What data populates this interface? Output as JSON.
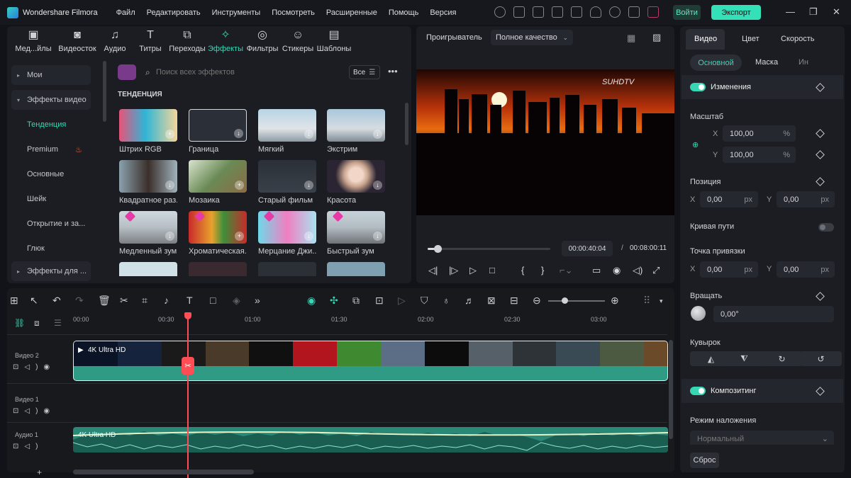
{
  "app": {
    "title": "Wondershare Filmora"
  },
  "menu": [
    "Файл",
    "Редактировать",
    "Инструменты",
    "Посмотреть",
    "Расширенные",
    "Помощь",
    "Версия"
  ],
  "titlebar": {
    "login": "Войти",
    "export": "Экспорт",
    "icons": [
      "check-circle-icon",
      "send-icon",
      "ai-icon",
      "monitor-icon",
      "save-icon",
      "cloud-icon",
      "headset-icon",
      "grid-icon",
      "cart-icon"
    ]
  },
  "tools": [
    {
      "label": "Мед...йлы",
      "icon": "media-icon"
    },
    {
      "label": "Видеосток",
      "icon": "stock-icon"
    },
    {
      "label": "Аудио",
      "icon": "music-icon"
    },
    {
      "label": "Титры",
      "icon": "text-icon"
    },
    {
      "label": "Переходы",
      "icon": "transition-icon"
    },
    {
      "label": "Эффекты",
      "icon": "effects-icon"
    },
    {
      "label": "Фильтры",
      "icon": "filter-icon"
    },
    {
      "label": "Стикеры",
      "icon": "sticker-icon"
    },
    {
      "label": "Шаблоны",
      "icon": "template-icon"
    }
  ],
  "sidebar": [
    {
      "label": "Мои"
    },
    {
      "label": "Эффекты видео"
    },
    {
      "label": "Тенденция"
    },
    {
      "label": "Premium"
    },
    {
      "label": "Основные"
    },
    {
      "label": "Шейк"
    },
    {
      "label": "Открытие и за..."
    },
    {
      "label": "Глюк"
    },
    {
      "label": "Эффекты для ..."
    }
  ],
  "search": {
    "placeholder": "Поиск всех эффектов",
    "filter": "Все"
  },
  "section_title": "ТЕНДЕНЦИЯ",
  "effects": [
    {
      "label": "Штрих RGB"
    },
    {
      "label": "Граница"
    },
    {
      "label": "Мягкий"
    },
    {
      "label": "Экстрим"
    },
    {
      "label": "Квадратное раз..."
    },
    {
      "label": "Мозаика"
    },
    {
      "label": "Старый фильм"
    },
    {
      "label": "Красота"
    },
    {
      "label": "Медленный зум"
    },
    {
      "label": "Хроматическая..."
    },
    {
      "label": "Мерцание Джи..."
    },
    {
      "label": "Быстрый зум"
    }
  ],
  "player": {
    "title": "Проигрыватель",
    "quality": "Полное качество",
    "watermark": "SUHDTV",
    "current_time": "00:00:40:04",
    "total_time": "00:08:00:11",
    "progress": 0.083
  },
  "inspector": {
    "tabs": [
      "Видео",
      "Цвет",
      "Скорость"
    ],
    "subtabs": [
      "Основной",
      "Маска",
      "Ин"
    ],
    "transform": "Изменения",
    "scale": "Масштаб",
    "scale_x": "100,00",
    "scale_y": "100,00",
    "percent": "%",
    "position": "Позиция",
    "pos_x": "0,00",
    "pos_y": "0,00",
    "px": "px",
    "path_curve": "Кривая пути",
    "anchor": "Точка привязки",
    "anchor_x": "0,00",
    "anchor_y": "0,00",
    "rotate": "Вращать",
    "rotate_value": "0,00°",
    "flip": "Кувырок",
    "compositing": "Композитинг",
    "blend_mode": "Режим наложения",
    "blend_value": "Нормальный",
    "reset": "Сброс",
    "x": "X",
    "y": "Y"
  },
  "timeline": {
    "ruler": [
      "00:00",
      "00:30",
      "01:00",
      "01:30",
      "02:00",
      "02:30",
      "03:00"
    ],
    "tracks": [
      {
        "name": "Видео 2",
        "clip": "4K Ultra HD"
      },
      {
        "name": "Видео 1",
        "clip": ""
      },
      {
        "name": "Аудио 1",
        "clip": "4K Ultra HD"
      }
    ]
  }
}
